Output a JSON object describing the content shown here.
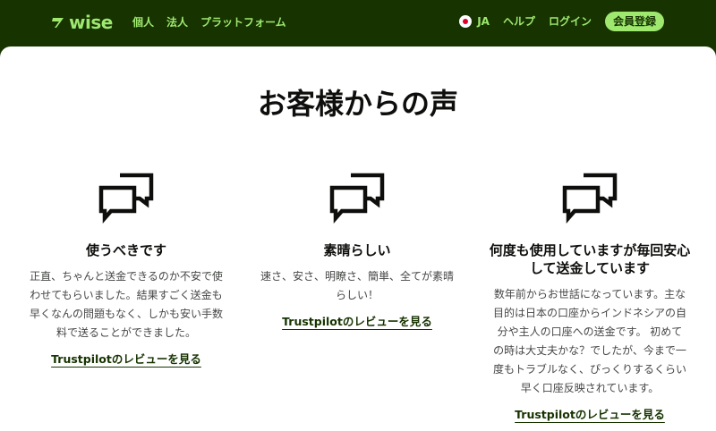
{
  "brand": {
    "name": "wise",
    "color": "#9fe870",
    "bg": "#163300"
  },
  "nav": {
    "left": [
      "個人",
      "法人",
      "プラットフォーム"
    ],
    "language": "JA",
    "help": "ヘルプ",
    "login": "ログイン",
    "signup": "会員登録"
  },
  "main": {
    "title": "お客様からの声",
    "reviews": [
      {
        "title": "使うべきです",
        "lines": [
          "正直、ちゃんと送金できるのか不安で使",
          "わせてもらいました。結果すごく送金も",
          "早くなんの問題もなく、しかも安い手数",
          "料で送ることができました。"
        ],
        "link": "Trustpilotのレビューを見る",
        "icon": "speech-bubbles-icon"
      },
      {
        "title": "素晴らしい",
        "lines": [
          "速さ、安さ、明瞭さ、簡単、全てが素晴",
          "らしい！"
        ],
        "link": "Trustpilotのレビューを見る",
        "icon": "speech-bubbles-icon"
      },
      {
        "title_lines": [
          "何度も使用していますが毎回安心",
          "して送金しています"
        ],
        "lines": [
          "数年前からお世話になっています。主な",
          "目的は日本の口座からインドネシアの自",
          "分や主人の口座への送金です。 初めて",
          "の時は大丈夫かな？でしたが、今まで一",
          "度もトラブルなく、ぴっくりするくらい",
          "早く口座反映されています。"
        ],
        "link": "Trustpilotのレビューを見る",
        "icon": "speech-bubbles-icon"
      }
    ]
  }
}
